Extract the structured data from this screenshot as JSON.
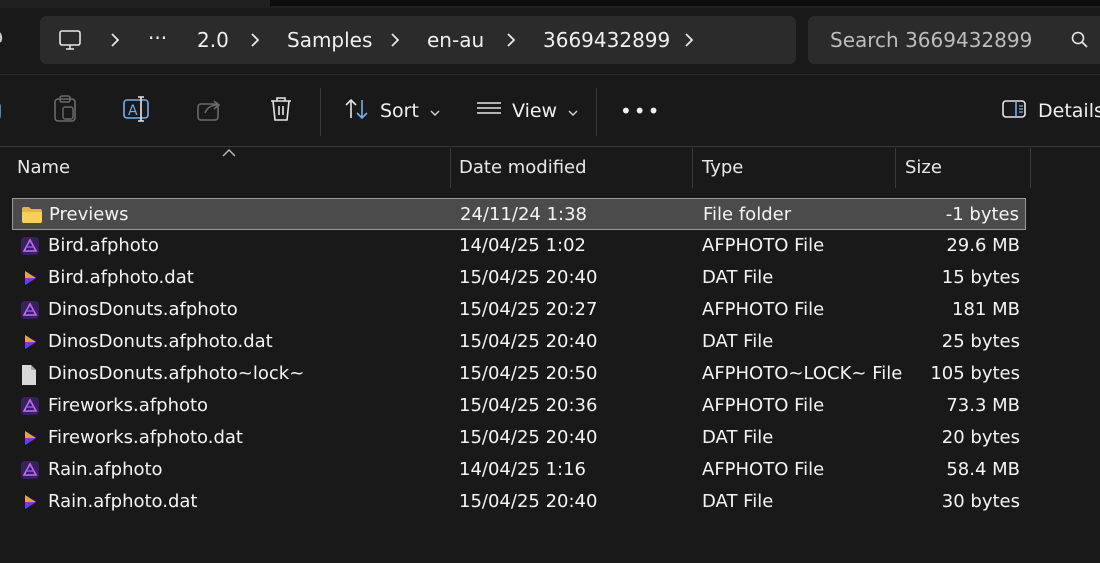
{
  "address": {
    "crumbs": [
      "2.0",
      "Samples",
      "en-au",
      "3669432899"
    ],
    "overflow": "···"
  },
  "search": {
    "placeholder": "Search 3669432899"
  },
  "toolbar": {
    "sort_label": "Sort",
    "view_label": "View",
    "more_label": "•••",
    "details_label": "Details"
  },
  "columns": {
    "name": "Name",
    "date": "Date modified",
    "type": "Type",
    "size": "Size"
  },
  "files": [
    {
      "name": "Previews",
      "date": "24/11/24 1:38",
      "type": "File folder",
      "size": "-1 bytes",
      "icon": "folder-icon",
      "selected": true
    },
    {
      "name": "Bird.afphoto",
      "date": "14/04/25 1:02",
      "type": "AFPHOTO File",
      "size": "29.6 MB",
      "icon": "affinity-photo-icon"
    },
    {
      "name": "Bird.afphoto.dat",
      "date": "15/04/25 20:40",
      "type": "DAT File",
      "size": "15 bytes",
      "icon": "dat-file-icon"
    },
    {
      "name": "DinosDonuts.afphoto",
      "date": "15/04/25 20:27",
      "type": "AFPHOTO File",
      "size": "181 MB",
      "icon": "affinity-photo-icon"
    },
    {
      "name": "DinosDonuts.afphoto.dat",
      "date": "15/04/25 20:40",
      "type": "DAT File",
      "size": "25 bytes",
      "icon": "dat-file-icon"
    },
    {
      "name": "DinosDonuts.afphoto~lock~",
      "date": "15/04/25 20:50",
      "type": "AFPHOTO~LOCK~ File",
      "size": "105 bytes",
      "icon": "generic-file-icon"
    },
    {
      "name": "Fireworks.afphoto",
      "date": "15/04/25 20:36",
      "type": "AFPHOTO File",
      "size": "73.3 MB",
      "icon": "affinity-photo-icon"
    },
    {
      "name": "Fireworks.afphoto.dat",
      "date": "15/04/25 20:40",
      "type": "DAT File",
      "size": "20 bytes",
      "icon": "dat-file-icon"
    },
    {
      "name": "Rain.afphoto",
      "date": "14/04/25 1:16",
      "type": "AFPHOTO File",
      "size": "58.4 MB",
      "icon": "affinity-photo-icon"
    },
    {
      "name": "Rain.afphoto.dat",
      "date": "15/04/25 20:40",
      "type": "DAT File",
      "size": "30 bytes",
      "icon": "dat-file-icon"
    }
  ]
}
